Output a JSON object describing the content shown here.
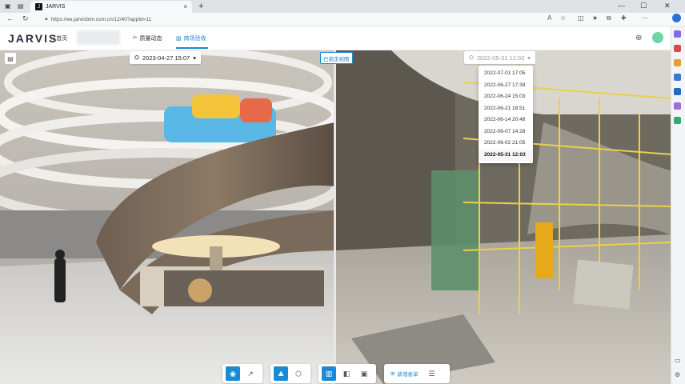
{
  "browser": {
    "tab_title": "JARVIS",
    "tab_close": "×",
    "new_tab": "+",
    "url": "https://ee.jarvisbim.com.cn/12/40?appId=11",
    "min": "—",
    "max": "☐",
    "close": "✕"
  },
  "app": {
    "logo": "JARVIS",
    "home": "首页",
    "nav": [
      {
        "label": "质量动态"
      },
      {
        "label": "商场验收"
      }
    ]
  },
  "left_view": {
    "date": "2023-04-27 15:07"
  },
  "right_view": {
    "lock_label": "已锁定视图",
    "date": "2022-05-31 12:03",
    "options": [
      "2022-07-01 17:05",
      "2022-06-27 17:39",
      "2022-06-24 15:03",
      "2022-06-21 18:51",
      "2022-06-14 20:48",
      "2022-06-07 14:28",
      "2022-06-02 21:05",
      "2022-05-31 12:03"
    ]
  },
  "toolbar": {
    "add_label": "新增表单"
  },
  "colors": {
    "accent": "#1a8ad6",
    "avatar": "#6fd6a3"
  }
}
